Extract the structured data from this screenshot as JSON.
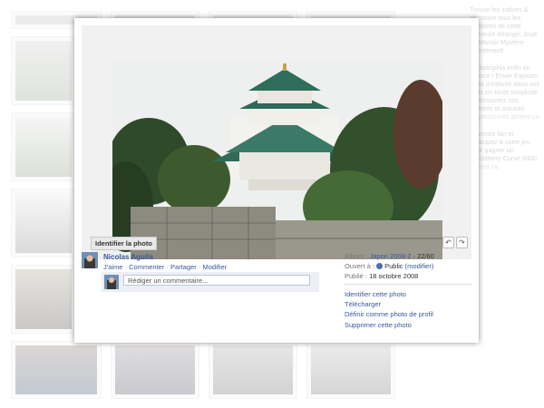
{
  "photo": {
    "tag_label": "Identifier la photo",
    "rotate_left_icon": "rotate-left-icon",
    "rotate_right_icon": "rotate-right-icon"
  },
  "author": {
    "name": "Nicolas Aguila",
    "actions": [
      "J'aime",
      "Commenter",
      "Partager",
      "Modifier"
    ],
    "separator": "·"
  },
  "comment": {
    "placeholder": "Rédiger un commentaire..."
  },
  "meta": {
    "album_label": "Album :",
    "album_link": "Japon 2008-2",
    "album_position": "· 22/60",
    "opened_label": "Ouvert à :",
    "opened_value": "Public",
    "opened_modify": "(modifier)",
    "published_label": "Publié :",
    "published_value": "18 octobre 2008"
  },
  "photo_actions": [
    "Identifier cette photo",
    "Télécharger",
    "Définir comme photo de profil",
    "Supprimer cette photo"
  ],
  "sidebar": {
    "blocks": [
      {
        "text": "Trouve les indices & découvre tous les mystères de cette demeure étrange! Joue au Manoir Mystère maintenant!",
        "sub": ""
      },
      {
        "text": "Philadelphia enfin en France ! Envie d'ajouter de la créativité dans vos plats en toute simplicité ? Découvrez nos recettes et astuces",
        "sub": "14 personnes aiment ça."
      },
      {
        "text": "Devenez fan et participez à notre jeu pour gagner un BlackBerry Curve 9300",
        "sub": "aiment ça."
      }
    ]
  },
  "colors": {
    "link": "#3b5998",
    "backdrop": "#ffffff",
    "tag_bg": "#e9e9e9"
  }
}
